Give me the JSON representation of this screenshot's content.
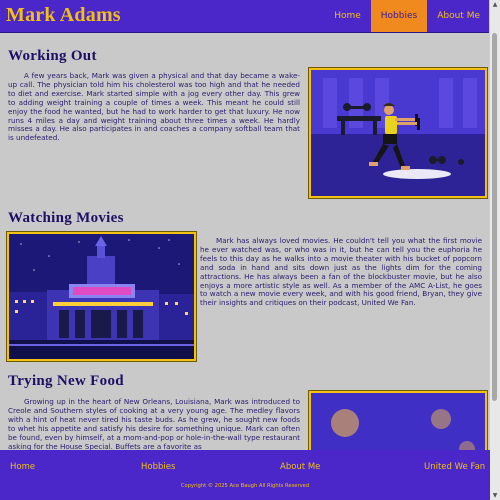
{
  "site": {
    "title": "Mark Adams"
  },
  "nav": {
    "items": [
      {
        "label": "Home"
      },
      {
        "label": "Hobbies"
      },
      {
        "label": "About Me"
      }
    ]
  },
  "sections": [
    {
      "heading": "Working Out",
      "body": "A few years back, Mark was given a physical and that day became a wake-up call. The physician told him his cholesterol was too high and that he needed to diet and exercise. Mark started simple with a jog every other day. This grew to adding weight training a couple of times a week. This meant he could still enjoy the food he wanted, but he had to work harder to get that luxury. He now runs 4 miles a day and weight training about three times a week. He hardly misses a day. He also participates in and coaches a company softball team that is undefeated."
    },
    {
      "heading": "Watching Movies",
      "body": "Mark has always loved movies. He couldn't tell you what the first movie he ever watched was, or who was in it, but he can tell you the euphoria he feels to this day as he walks into a movie theater with his bucket of popcorn and soda in hand and sits down just as the lights dim for the coming attractions. He has always been a fan of the blockbuster movie, but he also enjoys a more artistic style as well. As a member of the AMC A-List, he goes to watch a new movie every week, and with his good friend, Bryan, they give their insights and critiques on their podcast, United We Fan."
    },
    {
      "heading": "Trying New Food",
      "body": "Growing up in the heart of New Orleans, Louisiana, Mark was introduced to Creole and Southern styles of cooking at a very young age. The medley flavors with a hint of heat never tired his taste buds. As he grew, he sought new foods to whet his appetite and satisfy his desire for something unique. Mark can often be found, even by himself, at a mom-and-pop or hole-in-the-wall type restaurant asking for the House Special. Buffets are a favorite as"
    }
  ],
  "footer": {
    "links": [
      {
        "label": "Home"
      },
      {
        "label": "Hobbies"
      },
      {
        "label": "About Me"
      },
      {
        "label": "United We Fan"
      }
    ],
    "copyright": "Copyright © 2025 Ace Baugh All Rights Reserved"
  },
  "colors": {
    "brand": "#4b27c9",
    "accent": "#f2c014",
    "active": "#f08a1e",
    "background": "#c9c9c9"
  },
  "icons": {
    "scroll_up": "triangle-up",
    "scroll_down": "triangle-down"
  }
}
